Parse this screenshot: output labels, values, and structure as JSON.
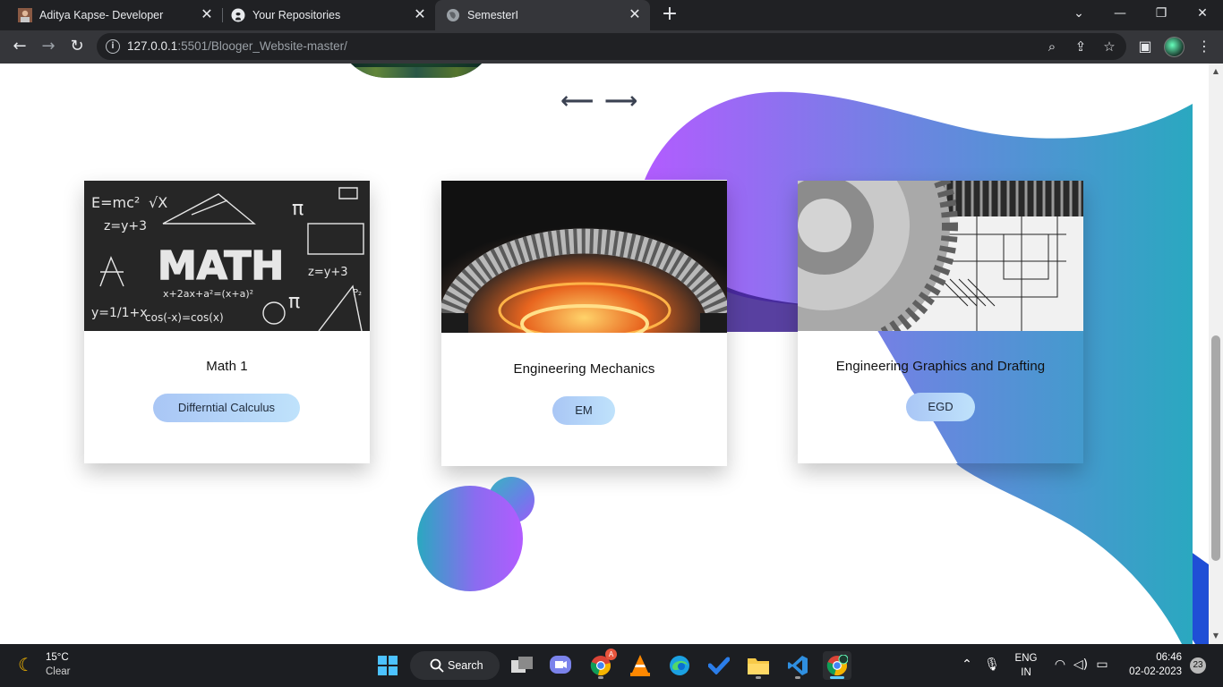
{
  "browser": {
    "tabs": [
      {
        "title": "Aditya Kapse- Developer",
        "favicon": "avatar-icon",
        "active": false
      },
      {
        "title": "Your Repositories",
        "favicon": "github-icon",
        "active": false
      },
      {
        "title": "SemesterI",
        "favicon": "globe-icon",
        "active": true
      }
    ],
    "url_host": "127.0.0.1",
    "url_path": ":5501/Blooger_Website-master/",
    "window_controls": [
      "minimize",
      "maximize",
      "close"
    ]
  },
  "page": {
    "nav": {
      "prev_icon": "arrow-left-icon",
      "next_icon": "arrow-right-icon"
    },
    "cards": [
      {
        "title": "Math 1",
        "tag": "Differntial Calculus",
        "image": "math-chalkboard-image"
      },
      {
        "title": "Engineering Mechanics",
        "tag": "EM",
        "image": "gear-machinery-image"
      },
      {
        "title": "Engineering Graphics and Drafting",
        "tag": "EGD",
        "image": "gear-drawing-image"
      }
    ],
    "colors": {
      "blob_start": "#b25cff",
      "blob_end": "#2aa8c0",
      "wave_blue": "#1f4fd6"
    }
  },
  "taskbar": {
    "weather": {
      "temp": "15°C",
      "condition": "Clear",
      "icon": "moon-icon"
    },
    "search_label": "Search",
    "apps": [
      "windows-start",
      "search",
      "task-view",
      "teams-chat",
      "chrome",
      "vlc",
      "edge",
      "todo",
      "file-explorer",
      "vscode",
      "chrome-active"
    ],
    "chrome_badge": "A",
    "language": "ENG",
    "region": "IN",
    "time": "06:46",
    "date": "02-02-2023",
    "notifications": "23"
  }
}
